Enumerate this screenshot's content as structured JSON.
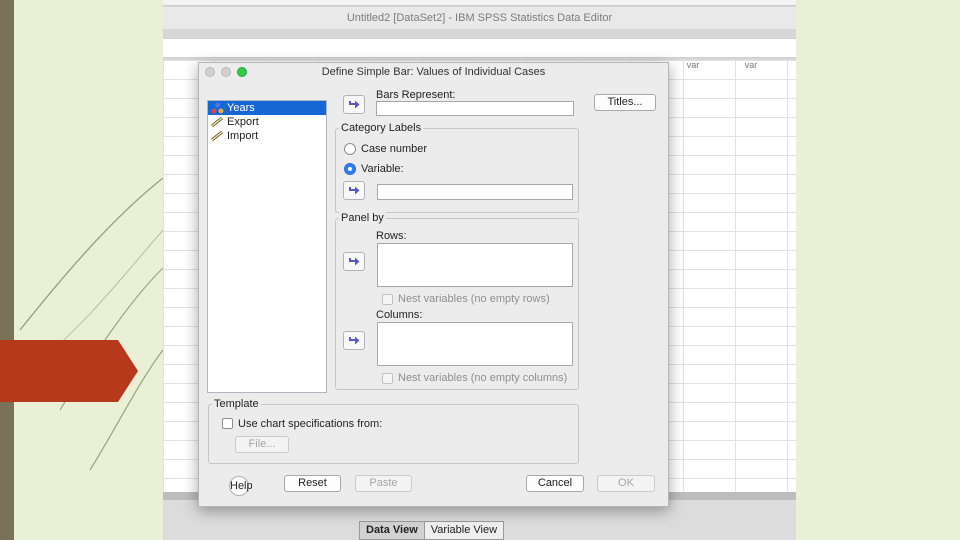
{
  "editor": {
    "window_title": "Untitled2 [DataSet2] - IBM SPSS Statistics Data Editor",
    "column_headers": [
      "var",
      "var"
    ],
    "view_tabs": [
      "Data View",
      "Variable View"
    ]
  },
  "dialog": {
    "title": "Define Simple Bar: Values of Individual Cases",
    "variables": [
      {
        "label": "Years",
        "icon": "nominal-variable-icon",
        "selected": true
      },
      {
        "label": "Export",
        "icon": "scale-variable-icon",
        "selected": false
      },
      {
        "label": "Import",
        "icon": "scale-variable-icon",
        "selected": false
      }
    ],
    "bars_represent_label": "Bars Represent:",
    "titles_button": "Titles...",
    "category_labels": {
      "group_label": "Category Labels",
      "case_number_label": "Case number",
      "variable_label": "Variable:",
      "selected_option": "Variable:"
    },
    "panel_by": {
      "group_label": "Panel by",
      "rows_label": "Rows:",
      "nest_rows_label": "Nest variables (no empty rows)",
      "columns_label": "Columns:",
      "nest_columns_label": "Nest variables (no empty columns)"
    },
    "template": {
      "group_label": "Template",
      "use_spec_label": "Use chart specifications from:",
      "file_button": "File..."
    },
    "buttons": {
      "help": "Help",
      "reset": "Reset",
      "paste": "Paste",
      "cancel": "Cancel",
      "ok": "OK"
    }
  },
  "colors": {
    "selection": "#1766d6",
    "slide_background": "#eaf0d6",
    "slide_accent": "#b5391a",
    "slide_bar": "#7a7256"
  }
}
